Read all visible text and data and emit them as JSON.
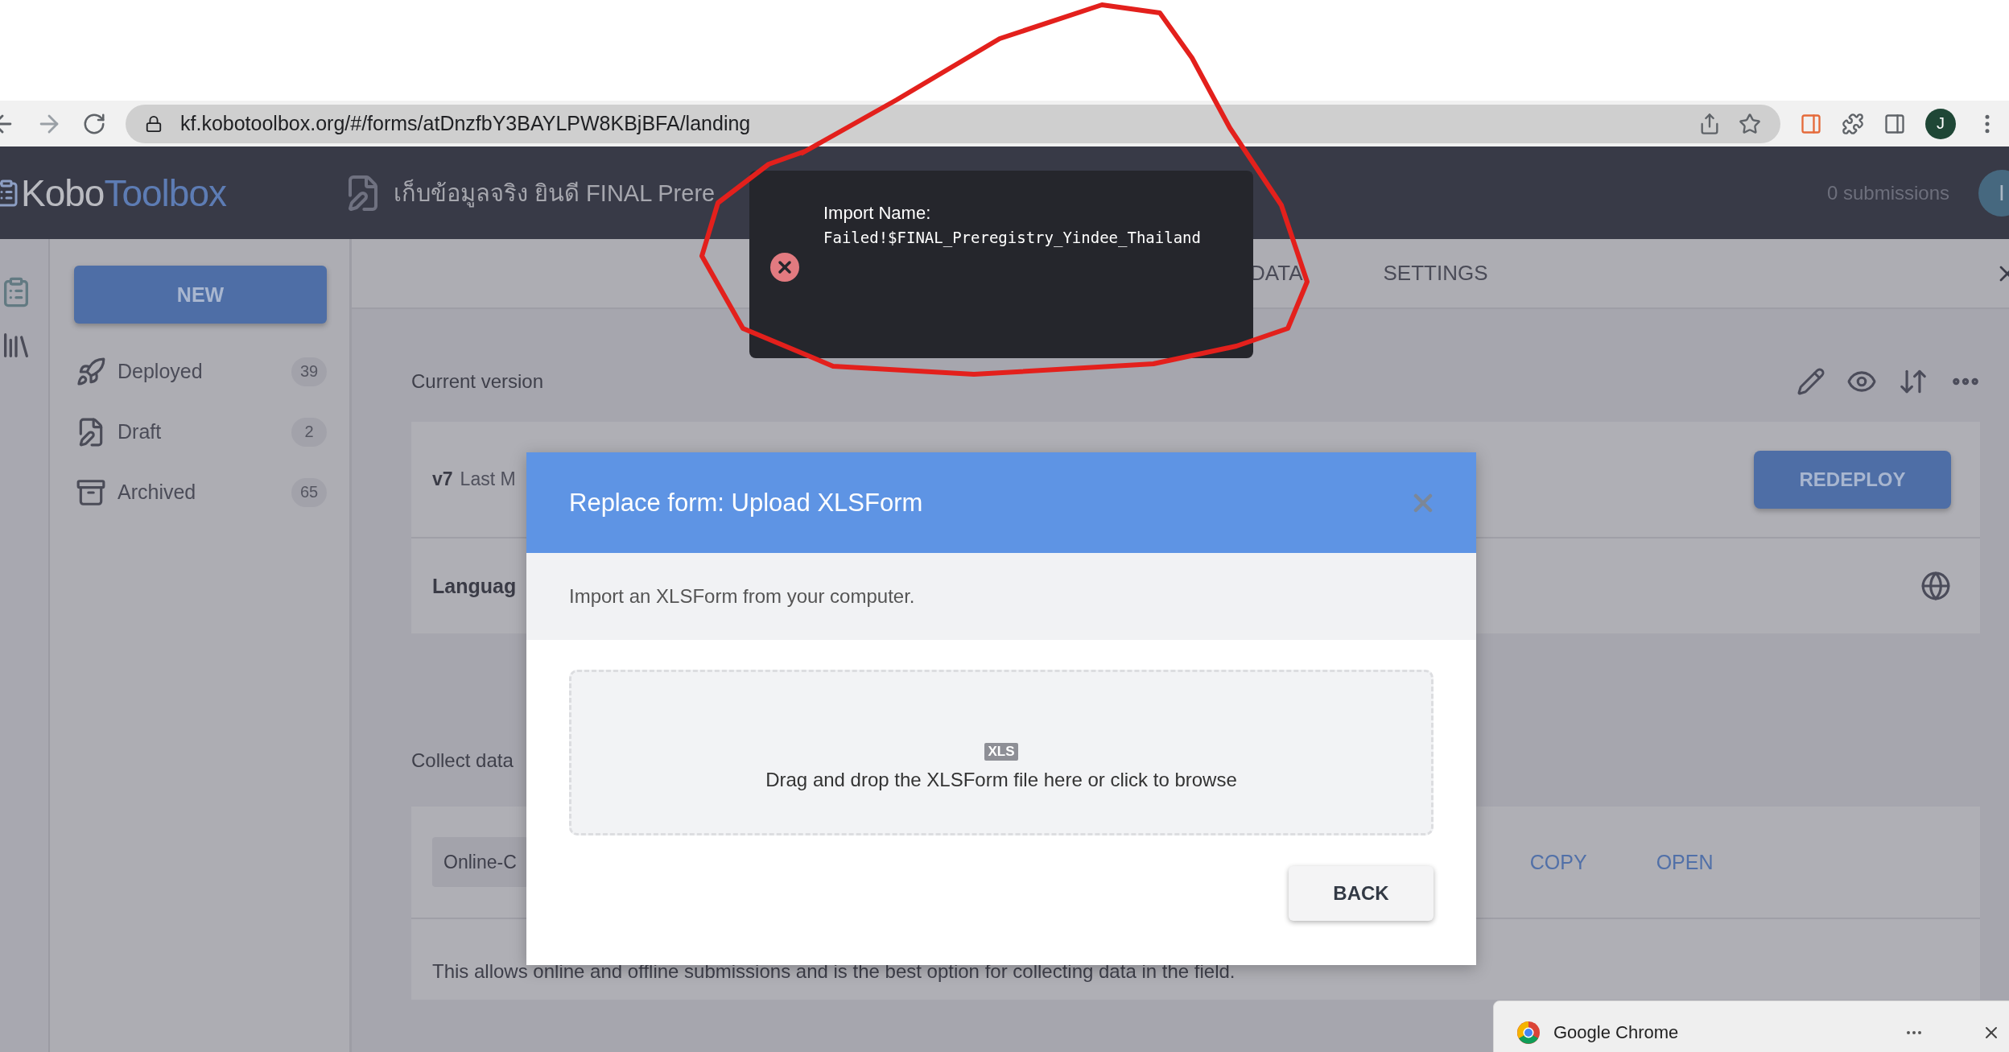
{
  "browser": {
    "url": "kf.kobotoolbox.org/#/forms/atDnzfbY3BAYLPW8KBjBFA/landing",
    "profile_initial": "J"
  },
  "header": {
    "logo_first": "Kobo",
    "logo_second": "Toolbox",
    "form_title": "เก็บข้อมูลจริง ยินดี FINAL Prere",
    "submissions": "0 submissions",
    "user_initial": "I"
  },
  "sidebar": {
    "new_button": "NEW",
    "items": [
      {
        "kind": "deployed",
        "label": "Deployed",
        "count": "39"
      },
      {
        "kind": "draft",
        "label": "Draft",
        "count": "2"
      },
      {
        "kind": "archived",
        "label": "Archived",
        "count": "65"
      }
    ]
  },
  "tabs": [
    {
      "label": "DATA",
      "selected": false
    },
    {
      "label": "SETTINGS",
      "selected": false
    }
  ],
  "current_version": {
    "label": "Current version",
    "version": "v7",
    "modified": "Last M",
    "redeploy": "REDEPLOY",
    "languages": "Languag"
  },
  "collect_data": {
    "label": "Collect data",
    "method": "Online-C",
    "copy": "COPY",
    "open": "OPEN",
    "description": "This allows online and offline submissions and is the best option for collecting data in the field."
  },
  "modal": {
    "title": "Replace form: Upload XLSForm",
    "subtitle": "Import an XLSForm from your computer.",
    "file_badge": "XLS",
    "dropzone_text": "Drag and drop the XLSForm file here or click to browse",
    "back": "BACK"
  },
  "toast": {
    "label": "Import Name:",
    "message": "Failed!$FINAL_Preregistry_Yindee_Thailand"
  },
  "notification": {
    "app": "Google Chrome"
  }
}
